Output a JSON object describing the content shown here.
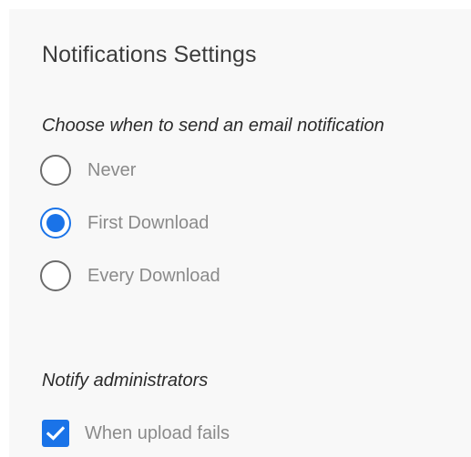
{
  "title": "Notifications Settings",
  "email_section": {
    "heading": "Choose when to send an email notification",
    "options": [
      {
        "label": "Never",
        "selected": false
      },
      {
        "label": "First Download",
        "selected": true
      },
      {
        "label": "Every Download",
        "selected": false
      }
    ]
  },
  "admin_section": {
    "heading": "Notify administrators",
    "checkbox": {
      "label": "When upload fails",
      "checked": true
    }
  },
  "colors": {
    "accent": "#1a73e8",
    "panel_background": "#f8f8f8",
    "label_text": "#8a8a8a"
  }
}
